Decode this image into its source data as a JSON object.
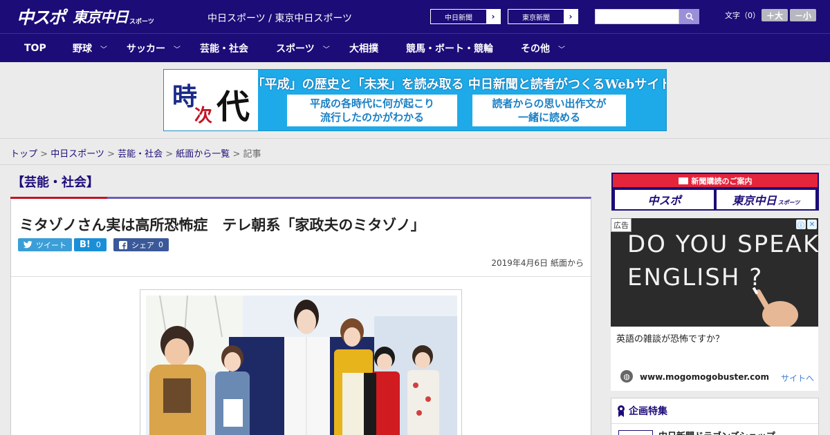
{
  "header": {
    "logo_main": "中スポ",
    "logo_tokyo": "東京中日",
    "logo_small": "スポーツ",
    "site_name": "中日スポーツ / 東京中日スポーツ",
    "paper_links": [
      {
        "label": "中日新聞",
        "arrow": "›"
      },
      {
        "label": "東京新聞",
        "arrow": "›"
      }
    ],
    "search_value": "",
    "font_size_label": "文字（0）",
    "font_larger": "＋大",
    "font_smaller": "－小"
  },
  "nav": {
    "items": [
      {
        "label": "TOP"
      },
      {
        "label": "野球",
        "chevron": "﹀"
      },
      {
        "label": "サッカー",
        "chevron": "﹀"
      },
      {
        "label": "芸能・社会"
      },
      {
        "label": "スポーツ",
        "chevron": "﹀"
      },
      {
        "label": "大相撲"
      },
      {
        "label": "競馬・ボート・競輪"
      },
      {
        "label": "その他",
        "chevron": "﹀"
      }
    ]
  },
  "banner": {
    "logo_ji": "時",
    "logo_tsugi": "次",
    "logo_dai": "代",
    "headline": "「平成」の歴史と「未来」を読み取る 中日新聞と読者がつくるWebサイト",
    "box_left_line1": "平成の各時代に何が起こり",
    "box_left_line2": "流行したのかがわかる",
    "box_right_line1": "読者からの思い出作文が",
    "box_right_line2": "一緒に読める"
  },
  "breadcrumb": {
    "items": [
      "トップ",
      "中日スポーツ",
      "芸能・社会",
      "紙面から一覧"
    ],
    "separator": " > ",
    "current": "記事"
  },
  "article": {
    "category": "【芸能・社会】",
    "headline": "ミタゾノさん実は高所恐怖症　テレ朝系「家政夫のミタゾノ」",
    "share": {
      "tweet": "ツイート",
      "hatena_label": "B!",
      "hatena_count": "0",
      "fb_label": "シェア",
      "fb_count": "0"
    },
    "dateline": "2019年4月6日 紙面から"
  },
  "sidebar": {
    "subscribe_title": "新聞購読のご案内",
    "subscribe_left": "中スポ",
    "subscribe_right": "東京中日",
    "subscribe_right_small": "スポーツ",
    "ad": {
      "label": "広告",
      "chalk_line1": "DO YOU SPEAK",
      "chalk_line2": "ENGLISH ?",
      "text": "英語の雑談が恐怖ですか？",
      "domain": "www.mogomogobuster.com",
      "site_link": "サイトへ"
    },
    "feature": {
      "title": "企画特集",
      "item": "中日新聞ドラゴンズショップ"
    }
  },
  "colors": {
    "brand_navy": "#1c0c78",
    "accent_red": "#c31424",
    "banner_blue": "#1eaae8"
  }
}
